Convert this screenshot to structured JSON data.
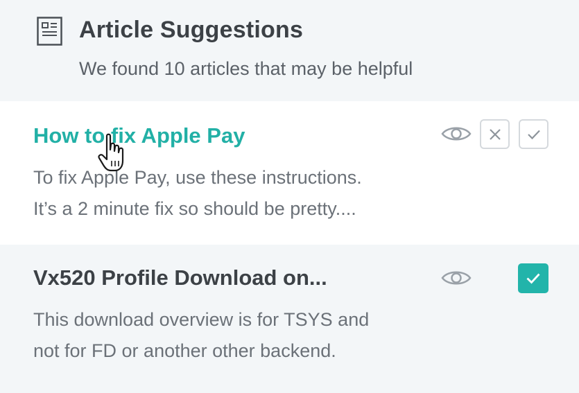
{
  "header": {
    "title": "Article Suggestions",
    "subtitle": "We found 10 articles that may be helpful",
    "icon": "article-icon"
  },
  "articles": [
    {
      "title": "How to fix Apple Pay",
      "snippet_line1": "To fix Apple Pay, use these instructions.",
      "snippet_line2": "It’s a 2 minute fix so should be pretty....",
      "state": "hovered",
      "actions": [
        "eye-icon",
        "dismiss-x-icon",
        "accept-check-icon"
      ]
    },
    {
      "title": "Vx520 Profile Download on...",
      "snippet_line1": "This download overview is for TSYS and",
      "snippet_line2": "not for FD or another other backend.",
      "state": "selected",
      "actions": [
        "eye-icon",
        "checkbox-checked-icon"
      ]
    }
  ],
  "colors": {
    "accent": "#22b0a6",
    "header_bg": "#f3f6f8",
    "text_dark": "#3c4146",
    "text_muted": "#6b7178"
  },
  "cursor": "hand-pointer-cursor-icon"
}
